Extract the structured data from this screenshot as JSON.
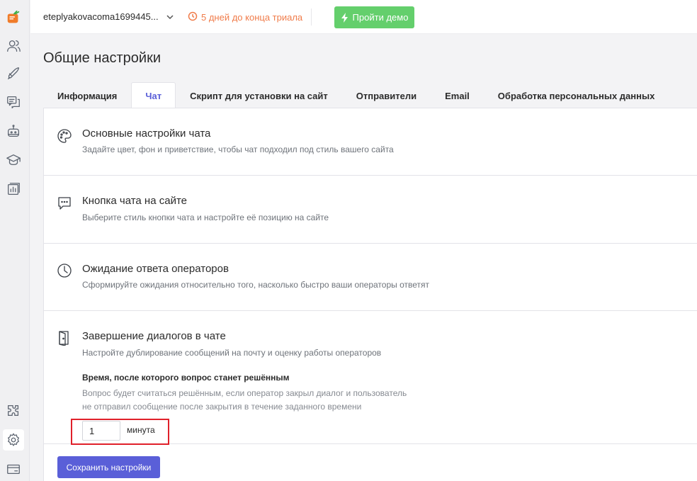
{
  "topbar": {
    "account": "eteplyakovacoma1699445...",
    "trial": "5 дней до конца триала",
    "demo_button": "Пройти демо"
  },
  "page": {
    "title": "Общие настройки"
  },
  "tabs": [
    {
      "label": "Информация"
    },
    {
      "label": "Чат"
    },
    {
      "label": "Скрипт для установки на сайт"
    },
    {
      "label": "Отправители"
    },
    {
      "label": "Email"
    },
    {
      "label": "Обработка персональных данных"
    }
  ],
  "active_tab": "Чат",
  "sections": [
    {
      "title": "Основные настройки чата",
      "desc": "Задайте цвет, фон и приветствие, чтобы чат подходил под стиль вашего сайта",
      "icon": "palette-icon"
    },
    {
      "title": "Кнопка чата на сайте",
      "desc": "Выберите стиль кнопки чата и настройте её позицию на сайте",
      "icon": "chat-bubble-icon"
    },
    {
      "title": "Ожидание ответа операторов",
      "desc": "Сформируйте ожидания относительно того, насколько быстро ваши операторы ответят",
      "icon": "clock-icon"
    },
    {
      "title": "Завершение диалогов в чате",
      "desc": "Настройте дублирование сообщений на почту и оценку работы операторов",
      "icon": "door-icon"
    }
  ],
  "resolve_setting": {
    "label": "Время, после которого вопрос станет решённым",
    "help_line1": "Вопрос будет считаться решённым, если оператор закрыл диалог и пользователь",
    "help_line2": "не отправил сообщение после закрытия в течение заданного времени",
    "value": "1",
    "unit": "минута"
  },
  "save_button": "Сохранить настройки",
  "colors": {
    "accent": "#5a5fd8",
    "demo": "#64cf6c",
    "trial": "#f07c4a",
    "highlight": "#e0202a"
  }
}
